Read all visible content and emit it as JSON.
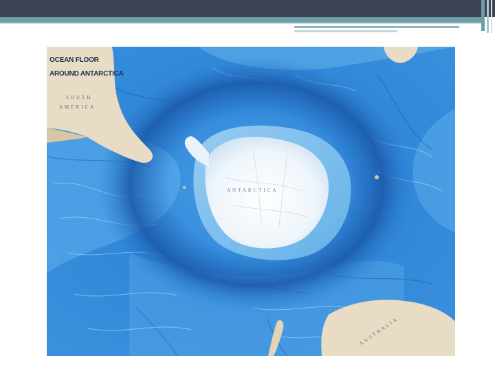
{
  "slide": {
    "colors": {
      "title_bar": "#3e4354",
      "accent": "#6f9ea6",
      "ocean": "#2f7fd0",
      "ice": "#f4f8fb",
      "land": "#e8dcc4"
    }
  },
  "map": {
    "title_line1": "OCEAN FLOOR",
    "title_line2": "AROUND ANTARCTICA",
    "labels": {
      "south_america_1": "SOUTH",
      "south_america_2": "AMERICA",
      "antarctica": "ANTARCTICA",
      "australia": "AUSTRALIA"
    }
  }
}
